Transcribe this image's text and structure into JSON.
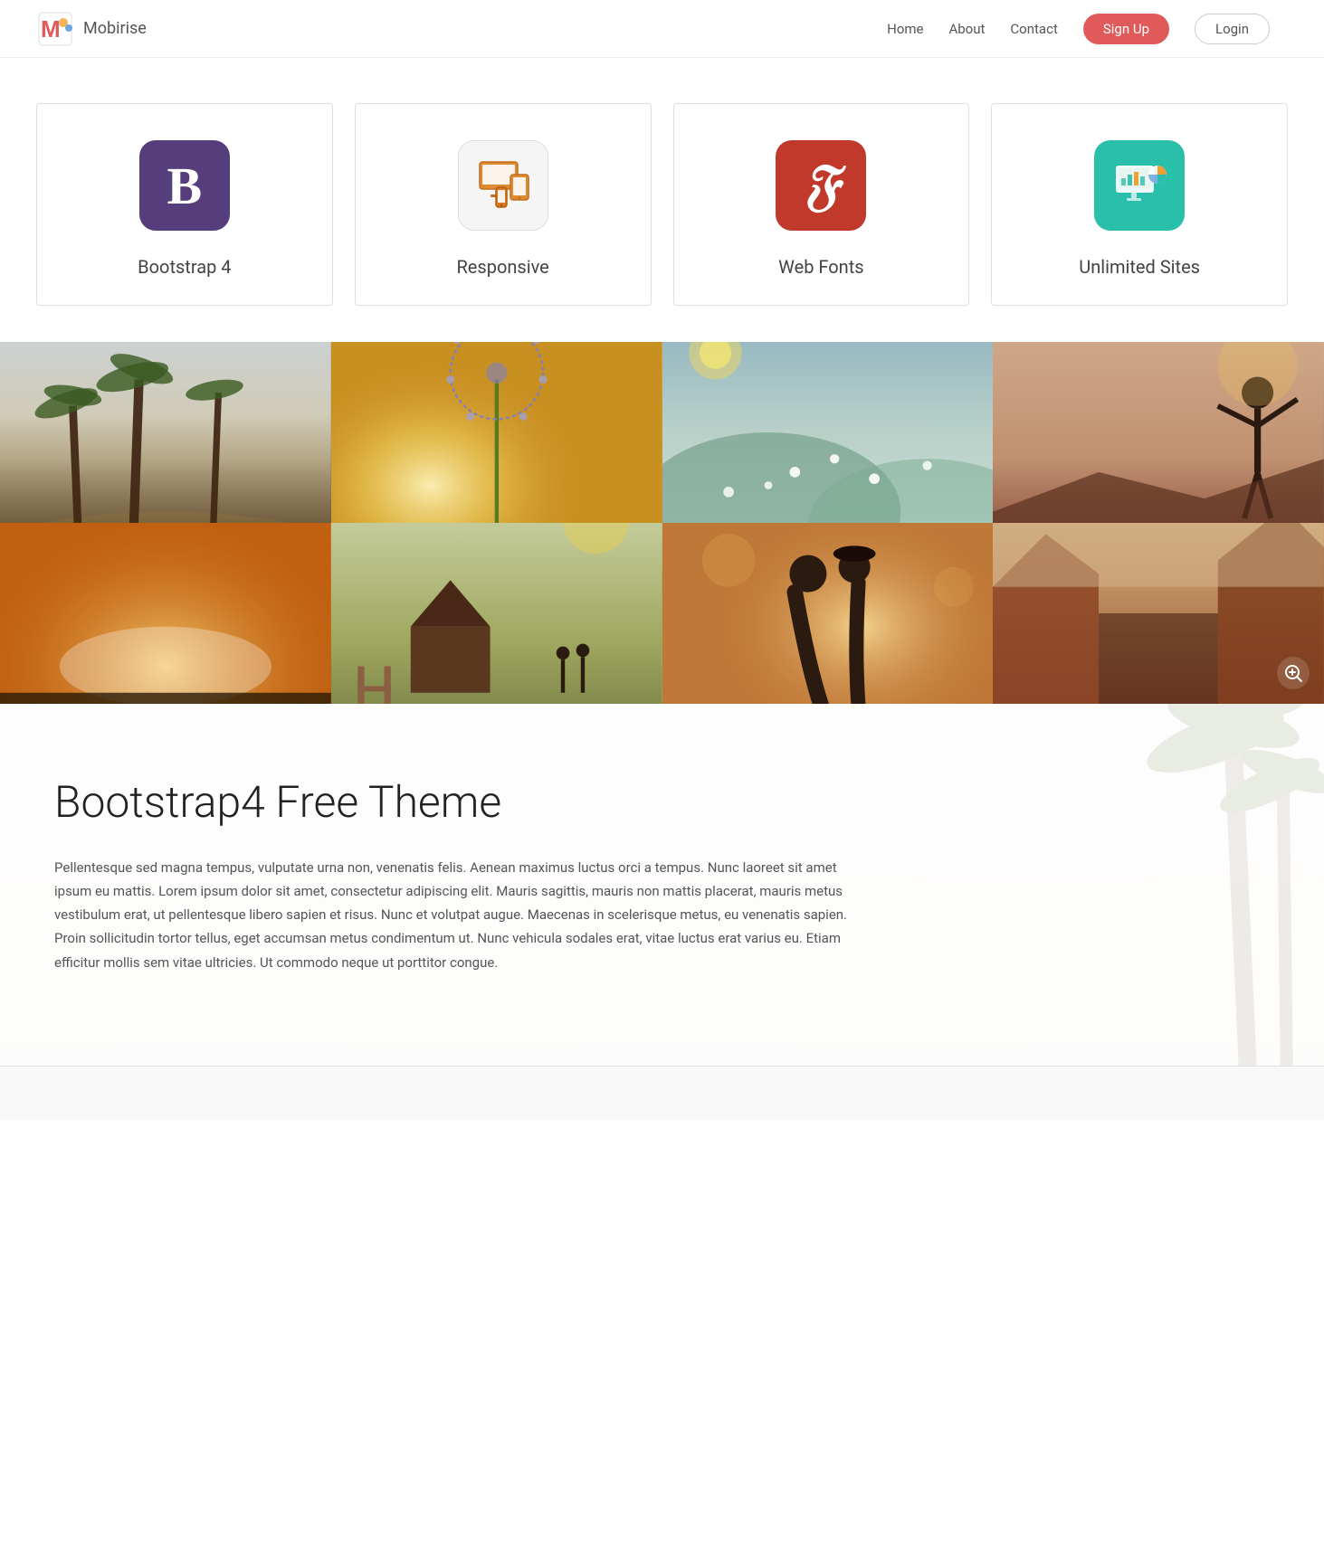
{
  "nav": {
    "logo_text": "Mobirise",
    "links": [
      {
        "label": "Home",
        "href": "#"
      },
      {
        "label": "About",
        "href": "#"
      },
      {
        "label": "Contact",
        "href": "#"
      }
    ],
    "signup_label": "Sign Up",
    "login_label": "Login"
  },
  "features": {
    "cards": [
      {
        "id": "bootstrap",
        "title": "Bootstrap 4",
        "icon_type": "bootstrap"
      },
      {
        "id": "responsive",
        "title": "Responsive",
        "icon_type": "responsive"
      },
      {
        "id": "webfonts",
        "title": "Web Fonts",
        "icon_type": "fonts"
      },
      {
        "id": "unlimited",
        "title": "Unlimited Sites",
        "icon_type": "unlimited"
      }
    ]
  },
  "text_section": {
    "heading": "Bootstrap4 Free Theme",
    "body": "Pellentesque sed magna tempus, vulputate urna non, venenatis felis. Aenean maximus luctus orci a tempus. Nunc laoreet sit amet ipsum eu mattis. Lorem ipsum dolor sit amet, consectetur adipiscing elit. Mauris sagittis, mauris non mattis placerat, mauris metus vestibulum erat, ut pellentesque libero sapien et risus. Nunc et volutpat augue. Maecenas in scelerisque metus, eu venenatis sapien. Proin sollicitudin tortor tellus, eget accumsan metus condimentum ut. Nunc vehicula sodales erat, vitae luctus erat varius eu. Etiam efficitur mollis sem vitae ultricies. Ut commodo neque ut porttitor congue."
  },
  "colors": {
    "signup_bg": "#e05a5a",
    "bootstrap_bg": "#563d7c",
    "fonts_bg": "#c0392b",
    "unlimited_bg": "#2abfaa",
    "responsive_bg": "#f5f5f5"
  }
}
